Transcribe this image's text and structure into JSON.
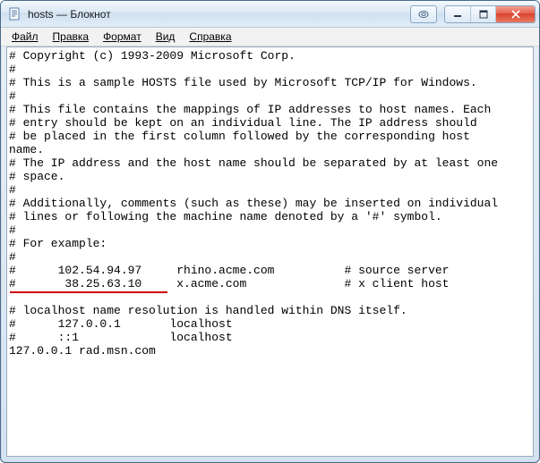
{
  "window": {
    "title": "hosts — Блокнот"
  },
  "menu": {
    "file": "Файл",
    "edit": "Правка",
    "format": "Формат",
    "view": "Вид",
    "help": "Справка"
  },
  "editor": {
    "content": "# Copyright (c) 1993-2009 Microsoft Corp.\n#\n# This is a sample HOSTS file used by Microsoft TCP/IP for Windows.\n#\n# This file contains the mappings of IP addresses to host names. Each\n# entry should be kept on an individual line. The IP address should\n# be placed in the first column followed by the corresponding host\nname.\n# The IP address and the host name should be separated by at least one\n# space.\n#\n# Additionally, comments (such as these) may be inserted on individual\n# lines or following the machine name denoted by a '#' symbol.\n#\n# For example:\n#\n#      102.54.94.97     rhino.acme.com          # source server\n#       38.25.63.10     x.acme.com              # x client host\n\n# localhost name resolution is handled within DNS itself.\n#      127.0.0.1       localhost\n#      ::1             localhost\n127.0.0.1 rad.msn.com"
  },
  "icons": {
    "help": "help-icon",
    "minimize": "minimize-icon",
    "maximize": "maximize-icon",
    "close": "close-icon",
    "app": "notepad-icon"
  }
}
